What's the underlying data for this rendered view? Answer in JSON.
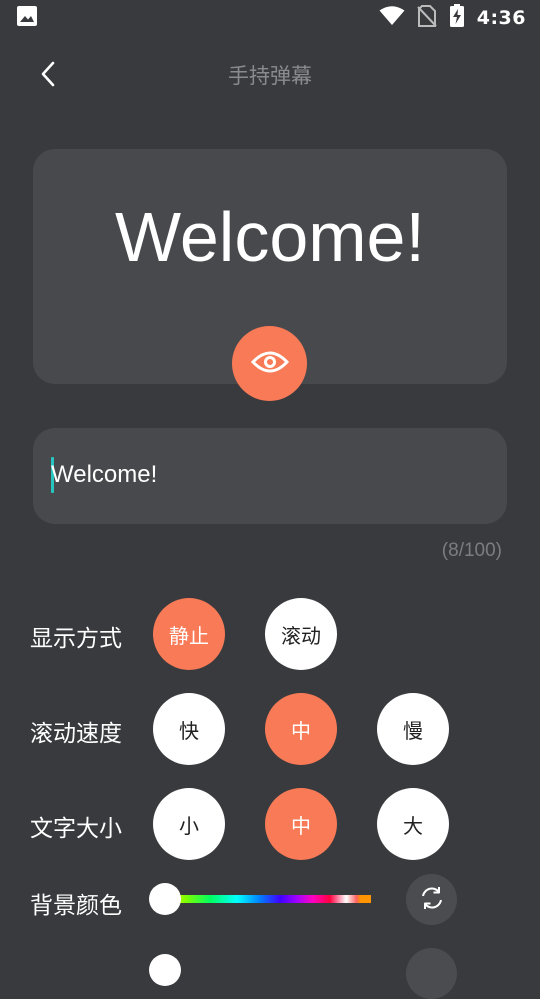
{
  "status_bar": {
    "time": "4:36",
    "icons": [
      "image-icon",
      "wifi-icon",
      "no-sim-icon",
      "battery-charging-icon"
    ]
  },
  "header": {
    "title": "手持弹幕",
    "back_icon": "chevron-left-icon"
  },
  "preview": {
    "text": "Welcome!",
    "preview_icon": "eye-icon"
  },
  "input": {
    "value": "Welcome!",
    "counter": "(8/100)"
  },
  "display_mode": {
    "label": "显示方式",
    "options": [
      {
        "label": "静止",
        "selected": true
      },
      {
        "label": "滚动",
        "selected": false
      }
    ]
  },
  "scroll_speed": {
    "label": "滚动速度",
    "options": [
      {
        "label": "快",
        "selected": false
      },
      {
        "label": "中",
        "selected": true
      },
      {
        "label": "慢",
        "selected": false
      }
    ]
  },
  "text_size": {
    "label": "文字大小",
    "options": [
      {
        "label": "小",
        "selected": false
      },
      {
        "label": "中",
        "selected": true
      },
      {
        "label": "大",
        "selected": false
      }
    ]
  },
  "background_color": {
    "label": "背景颜色",
    "reset_icon": "refresh-icon"
  },
  "colors": {
    "accent": "#f87a56",
    "background": "#393a3e",
    "card": "#48494d",
    "caret": "#28c5c0"
  }
}
